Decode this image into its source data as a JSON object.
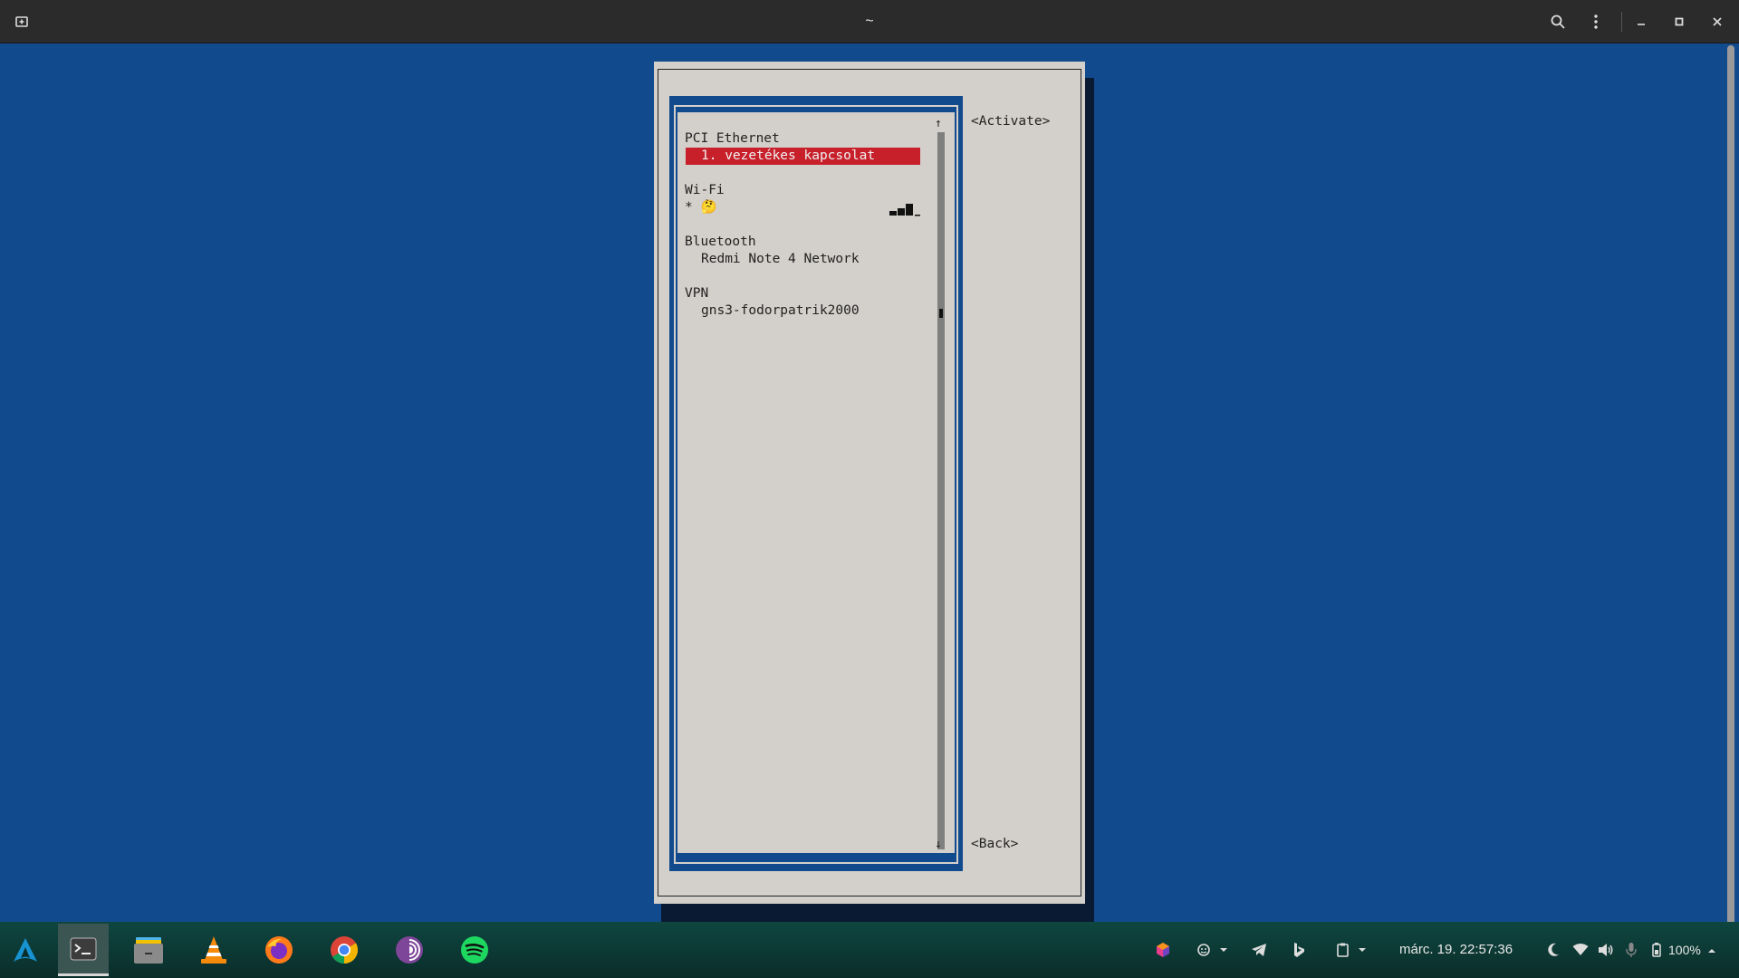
{
  "window": {
    "title": "~"
  },
  "titlebar_icons": [
    "new-tab-icon",
    "search-icon",
    "kebab-menu-icon",
    "minimize-icon",
    "maximize-icon",
    "close-icon"
  ],
  "nmtui": {
    "groups": [
      {
        "header": "PCI Ethernet",
        "items": [
          "1. vezetékes kapcsolat"
        ]
      },
      {
        "header": "Wi-Fi",
        "items": [
          "* 🤔"
        ]
      },
      {
        "header": "Bluetooth",
        "items": [
          "Redmi Note 4 Network"
        ]
      },
      {
        "header": "VPN",
        "items": [
          "gns3-fodorpatrik2000"
        ]
      }
    ],
    "selected_item": "1. vezetékes kapcsolat",
    "scroll_up": "↑",
    "scroll_down": "↓",
    "activate_label": "<Activate>",
    "back_label": "<Back>",
    "colors": {
      "background": "#124a8e",
      "dialog": "#d3d0cb",
      "selection": "#c8202b"
    }
  },
  "taskbar": {
    "apps": [
      "launcher",
      "terminal",
      "files",
      "vlc",
      "firefox",
      "chrome",
      "tor-browser",
      "spotify"
    ],
    "active_app": "terminal",
    "tray_icons": [
      "colorful-app-icon",
      "user-status-icon",
      "telegram-icon",
      "bing-icon",
      "clipboard-icon",
      "night-light-icon",
      "wifi-icon",
      "volume-icon",
      "microphone-icon",
      "battery-icon"
    ],
    "clock": "márc. 19.  22:57:36",
    "battery": "100%"
  }
}
